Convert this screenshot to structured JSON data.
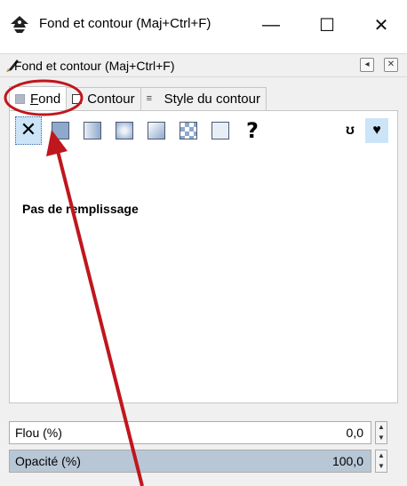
{
  "window": {
    "title": "Fond et contour (Maj+Ctrl+F)",
    "minimize_glyph": "—",
    "maximize_glyph": "☐",
    "close_glyph": "✕"
  },
  "dock": {
    "title": "Fond et contour (Maj+Ctrl+F)",
    "iconify_glyph": "◂",
    "close_glyph": "✕"
  },
  "tabs": [
    {
      "label_first": "F",
      "label_rest": "ond",
      "active": true
    },
    {
      "label": "Contour",
      "active": false
    },
    {
      "label": "Style du contour",
      "active": false
    }
  ],
  "paint_modes": [
    {
      "name": "no-paint",
      "glyph": "✕",
      "selected": true
    },
    {
      "name": "flat-color"
    },
    {
      "name": "linear-gradient"
    },
    {
      "name": "radial-gradient"
    },
    {
      "name": "mesh-gradient"
    },
    {
      "name": "pattern"
    },
    {
      "name": "swatch"
    },
    {
      "name": "unset",
      "glyph": "?"
    }
  ],
  "fill_rules": [
    {
      "name": "fill-rule-evenodd",
      "glyph": "ʊ"
    },
    {
      "name": "fill-rule-nonzero",
      "glyph": "♥",
      "selected": true
    }
  ],
  "fill_status": "Pas de remplissage",
  "blur": {
    "label": "Flou (%)",
    "value": "0,0",
    "fraction": 0.0
  },
  "opacity": {
    "label": "Opacité (%)",
    "value": "100,0",
    "fraction": 1.0
  },
  "annotation": {
    "color": "#c0161d"
  }
}
